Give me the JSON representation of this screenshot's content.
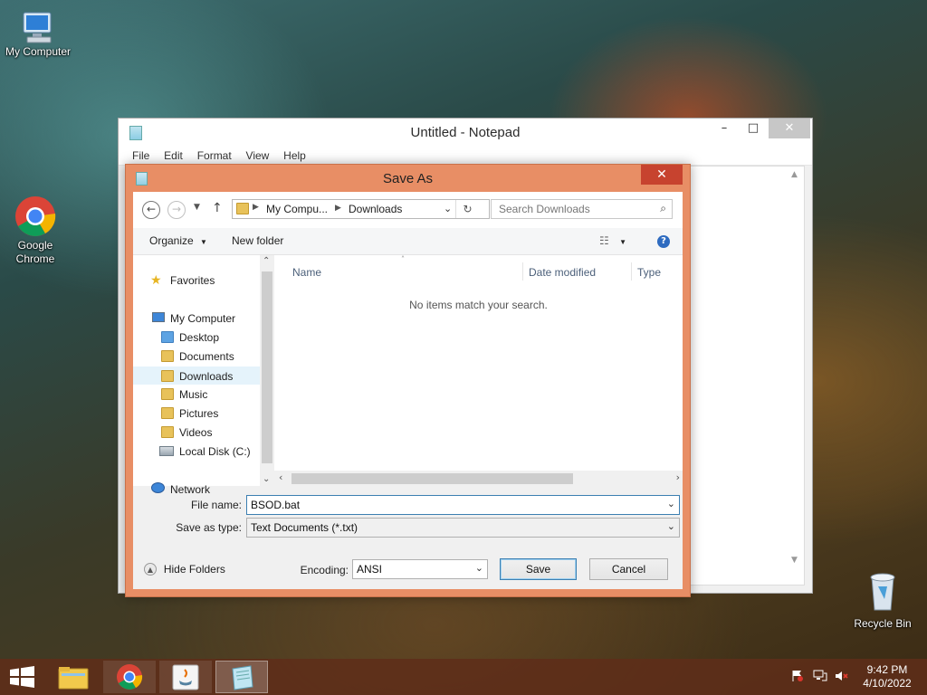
{
  "desktop": {
    "icons": [
      {
        "label": "My Computer",
        "icon": "computer-icon"
      },
      {
        "label": "Google Chrome",
        "icon": "chrome-icon"
      },
      {
        "label": "Recycle Bin",
        "icon": "recycle-bin-icon"
      }
    ]
  },
  "notepad": {
    "title": "Untitled - Notepad",
    "menu": [
      "File",
      "Edit",
      "Format",
      "View",
      "Help"
    ],
    "controls": {
      "minimize": "–",
      "maximize": "□",
      "close": "✕"
    }
  },
  "save_as": {
    "title": "Save As",
    "close": "✕",
    "address": {
      "crumb1": "My Compu...",
      "crumb2": "Downloads"
    },
    "search": {
      "placeholder": "Search Downloads"
    },
    "toolbar": {
      "organize": "Organize",
      "new_folder": "New folder"
    },
    "nav": {
      "favorites": "Favorites",
      "computer": "My Computer",
      "items": [
        "Desktop",
        "Documents",
        "Downloads",
        "Music",
        "Pictures",
        "Videos",
        "Local Disk (C:)"
      ],
      "network": "Network",
      "selected": "Downloads"
    },
    "columns": {
      "name": "Name",
      "date_modified": "Date modified",
      "type": "Type"
    },
    "empty_message": "No items match your search.",
    "file_name_label": "File name:",
    "file_name_value": "BSOD.bat",
    "save_as_type_label": "Save as type:",
    "save_as_type_value": "Text Documents (*.txt)",
    "hide_folders": "Hide Folders",
    "encoding_label": "Encoding:",
    "encoding_value": "ANSI",
    "save_button": "Save",
    "cancel_button": "Cancel"
  },
  "taskbar": {
    "apps": [
      "windows-start-icon",
      "file-explorer-icon",
      "chrome-icon",
      "java-icon",
      "notepad-icon"
    ],
    "clock_time": "9:42 PM",
    "clock_date": "4/10/2022"
  },
  "colors": {
    "dialog_frame": "#e88e65",
    "dialog_close": "#c7432f",
    "taskbar": "#5f2d19"
  }
}
